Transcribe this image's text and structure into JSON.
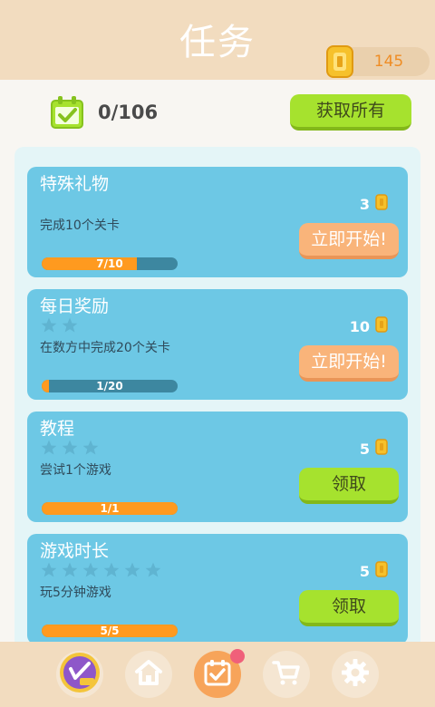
{
  "header": {
    "title": "任务",
    "coins": "145"
  },
  "summary": {
    "progress": "0/106",
    "collect_all_label": "获取所有"
  },
  "tasks": [
    {
      "name": "特殊礼物",
      "stars": 0,
      "description": "完成10个关卡",
      "reward": "3",
      "progress_text": "7/10",
      "progress": 0.7,
      "action_label": "立即开始!",
      "action_type": "start"
    },
    {
      "name": "每日奖励",
      "stars": 2,
      "description": "在数方中完成20个关卡",
      "reward": "10",
      "progress_text": "1/20",
      "progress": 0.05,
      "action_label": "立即开始!",
      "action_type": "start"
    },
    {
      "name": "教程",
      "stars": 3,
      "description": "尝试1个游戏",
      "reward": "5",
      "progress_text": "1/1",
      "progress": 1.0,
      "action_label": "领取",
      "action_type": "claim"
    },
    {
      "name": "游戏时长",
      "stars": 6,
      "description": "玩5分钟游戏",
      "reward": "5",
      "progress_text": "5/5",
      "progress": 1.0,
      "action_label": "领取",
      "action_type": "claim"
    }
  ],
  "footer": {
    "items": [
      {
        "icon": "vip-icon",
        "active": false
      },
      {
        "icon": "home-icon",
        "active": false
      },
      {
        "icon": "calendar-check-icon",
        "active": true,
        "badge": true
      },
      {
        "icon": "cart-icon",
        "active": false
      },
      {
        "icon": "gear-icon",
        "active": false
      }
    ]
  },
  "colors": {
    "accent_green": "#a6e22e",
    "accent_orange": "#f9b47a",
    "card_blue": "#6dc8e5",
    "header_beige": "#f2dcbf"
  }
}
